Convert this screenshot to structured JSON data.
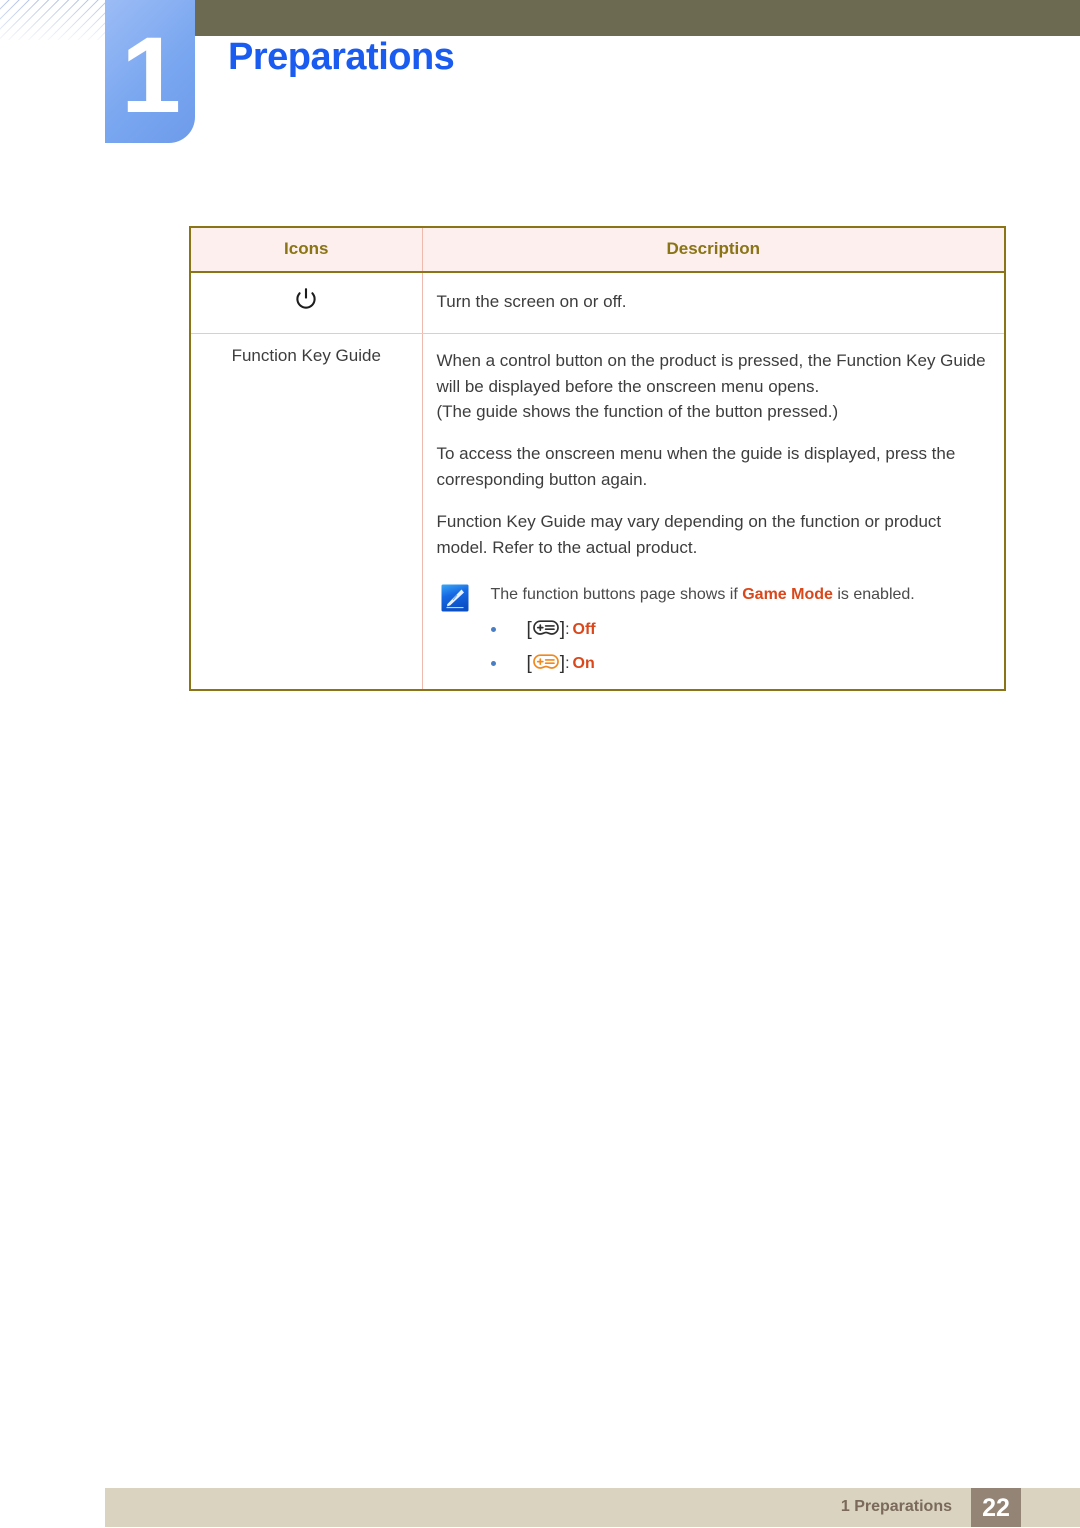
{
  "header": {
    "chapter_number": "1",
    "chapter_title": "Preparations",
    "band_color": "#6d6a52",
    "badge_color": "#7aa7f0",
    "title_color": "#1a5cf0"
  },
  "table": {
    "columns": [
      "Icons",
      "Description"
    ],
    "header_text_color": "#8a7415",
    "header_bg_color": "#fcefee",
    "border_color": "#8a7415",
    "rows": [
      {
        "icon_name": "power-icon",
        "icon_label": "",
        "description": "Turn the screen on or off."
      },
      {
        "icon_name": "function-key-guide",
        "icon_label": "Function Key Guide",
        "paragraphs": [
          "When a control button on the product is pressed, the Function Key Guide will be displayed before the onscreen menu opens.\n(The guide shows the function of the button pressed.)",
          "To access the onscreen menu when the guide is displayed, press the corresponding button again.",
          "Function Key Guide may vary depending on the function or product model. Refer to the actual product."
        ],
        "note": {
          "icon_name": "note-pencil-icon",
          "text_before": "The function buttons page shows if ",
          "highlight": "Game Mode",
          "text_after": " is enabled.",
          "highlight_color": "#d9471a",
          "items": [
            {
              "icon_name": "gamepad-icon-black",
              "icon_color": "#2f2f2f",
              "separator": ": ",
              "state": "Off"
            },
            {
              "icon_name": "gamepad-icon-orange",
              "icon_color": "#f0881e",
              "separator": ": ",
              "state": "On"
            }
          ]
        }
      }
    ]
  },
  "footer": {
    "text": "1 Preparations",
    "page_number": "22",
    "band_color": "#d9d3c0",
    "page_box_color": "#938476"
  }
}
